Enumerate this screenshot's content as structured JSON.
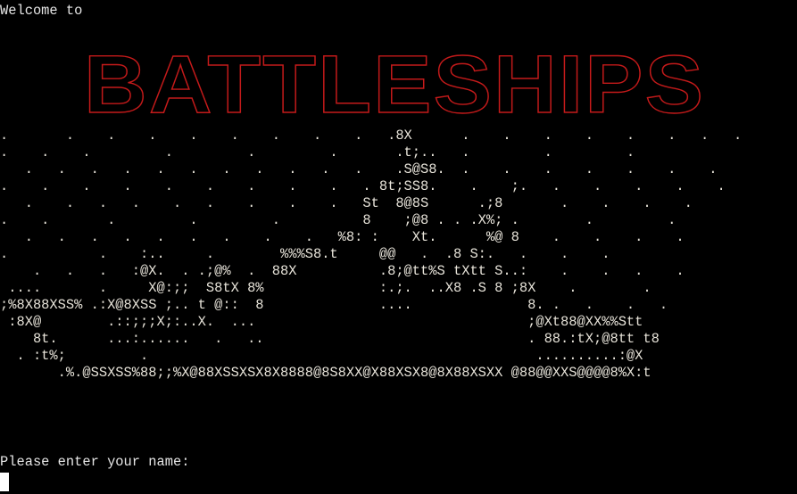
{
  "terminal": {
    "welcome_text": "Welcome to",
    "logo_text": "BATTLESHIPS",
    "prompt_text": "Please enter your name:",
    "input_value": "",
    "colors": {
      "background": "#000000",
      "text": "#e6e6e6",
      "logo": "#c41a1a",
      "cursor": "#ffffff"
    }
  },
  "ascii_art": [
    ".       .    .    .    .    .    .    .    .   .8X      .    .    .    .    .    .   .   .",
    ".    .    .         .         .         .       .t;..   .         .         .",
    "   .   .   .   .   .   .   .   .   .   .   .    .S@S8.  .    .    .    .    .    .    .",
    ".    .    .    .    .    .    .    .    .   . 8t;SS8.    .    ;.   .    .    .    .    .",
    "   .    .   .   .    .   .    .    .    .   St  8@8S      .;8       .    .    .    .",
    ".    .       .         .         .          8    ;@8 . . .X%; .        .         .",
    "   .   .   .   .   .   .   .    .    .   %8: :    Xt.      %@ 8    .    .    .    .",
    ".           .    :..     .        %%%S8.t     @@   .  .8 S:.   .    .    .",
    "    .   .   .   :@X.  . .;@%  .  88X          .8;@tt%S tXtt S..:    .    .   .    .",
    " ....       .     X@:;;  S8tX 8%              :.;.  ..X8 .S 8 ;8X    .        .",
    ";%8X88XSS% .:X@8XSS ;.. t @::  8              ....              8. .   .    .   .",
    " :8X@        .::;;;X;:..X.  ...                                 ;@Xt88@XX%%Stt",
    "    8t.      ...:......   .   ..                                . 88.:tX;@8tt t8",
    "  . :t%;         .                                               ..........:@X",
    "       .%.@SSXSS%88;;%X@88XSSXSX8X8888@8S8XX@X88XSX8@8X88XSXX @88@@XXS@@@@8%X:t"
  ]
}
